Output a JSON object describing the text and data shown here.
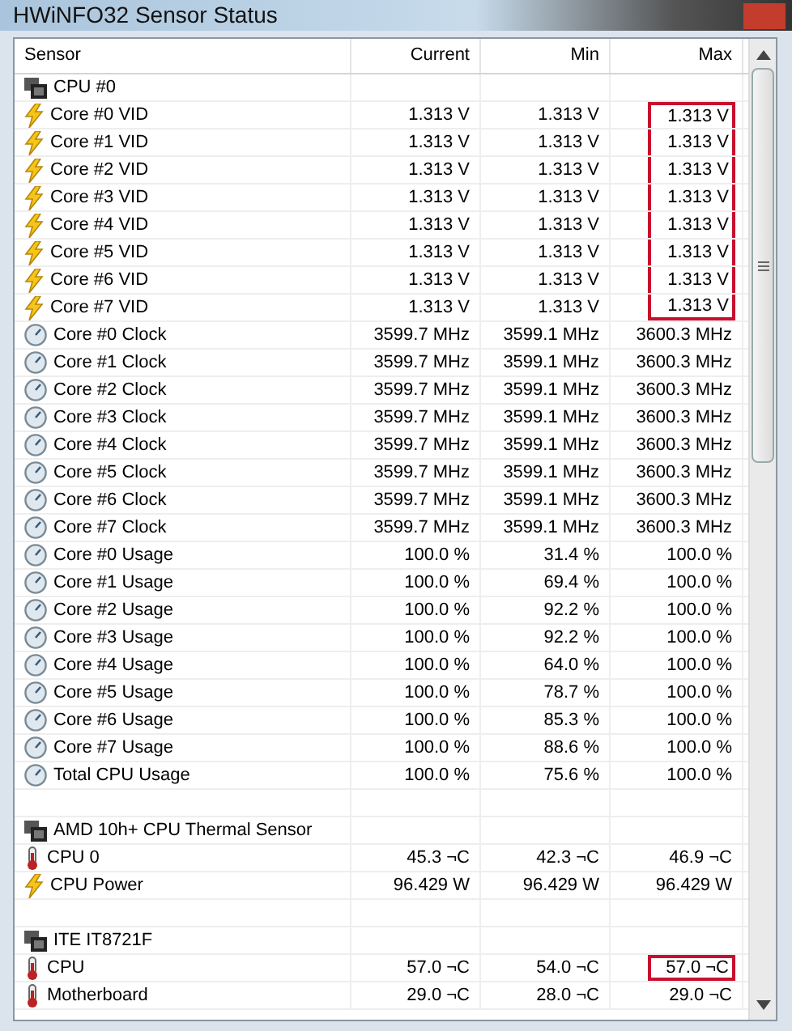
{
  "window": {
    "title": "HWiNFO32 Sensor Status"
  },
  "table": {
    "columns": [
      "Sensor",
      "Current",
      "Min",
      "Max"
    ],
    "rows": [
      {
        "kind": "group",
        "name": "CPU #0"
      },
      {
        "kind": "voltage",
        "name": "Core #0 VID",
        "current": "1.313 V",
        "min": "1.313 V",
        "max": "1.313 V",
        "highlighted": true
      },
      {
        "kind": "voltage",
        "name": "Core #1 VID",
        "current": "1.313 V",
        "min": "1.313 V",
        "max": "1.313 V",
        "highlighted": true
      },
      {
        "kind": "voltage",
        "name": "Core #2 VID",
        "current": "1.313 V",
        "min": "1.313 V",
        "max": "1.313 V",
        "highlighted": true
      },
      {
        "kind": "voltage",
        "name": "Core #3 VID",
        "current": "1.313 V",
        "min": "1.313 V",
        "max": "1.313 V",
        "highlighted": true
      },
      {
        "kind": "voltage",
        "name": "Core #4 VID",
        "current": "1.313 V",
        "min": "1.313 V",
        "max": "1.313 V",
        "highlighted": true
      },
      {
        "kind": "voltage",
        "name": "Core #5 VID",
        "current": "1.313 V",
        "min": "1.313 V",
        "max": "1.313 V",
        "highlighted": true
      },
      {
        "kind": "voltage",
        "name": "Core #6 VID",
        "current": "1.313 V",
        "min": "1.313 V",
        "max": "1.313 V",
        "highlighted": true
      },
      {
        "kind": "voltage",
        "name": "Core #7 VID",
        "current": "1.313 V",
        "min": "1.313 V",
        "max": "1.313 V",
        "highlighted": true
      },
      {
        "kind": "clock",
        "name": "Core #0 Clock",
        "current": "3599.7 MHz",
        "min": "3599.1 MHz",
        "max": "3600.3 MHz",
        "highlighted": false
      },
      {
        "kind": "clock",
        "name": "Core #1 Clock",
        "current": "3599.7 MHz",
        "min": "3599.1 MHz",
        "max": "3600.3 MHz",
        "highlighted": false
      },
      {
        "kind": "clock",
        "name": "Core #2 Clock",
        "current": "3599.7 MHz",
        "min": "3599.1 MHz",
        "max": "3600.3 MHz",
        "highlighted": false
      },
      {
        "kind": "clock",
        "name": "Core #3 Clock",
        "current": "3599.7 MHz",
        "min": "3599.1 MHz",
        "max": "3600.3 MHz",
        "highlighted": false
      },
      {
        "kind": "clock",
        "name": "Core #4 Clock",
        "current": "3599.7 MHz",
        "min": "3599.1 MHz",
        "max": "3600.3 MHz",
        "highlighted": false
      },
      {
        "kind": "clock",
        "name": "Core #5 Clock",
        "current": "3599.7 MHz",
        "min": "3599.1 MHz",
        "max": "3600.3 MHz",
        "highlighted": false
      },
      {
        "kind": "clock",
        "name": "Core #6 Clock",
        "current": "3599.7 MHz",
        "min": "3599.1 MHz",
        "max": "3600.3 MHz",
        "highlighted": false
      },
      {
        "kind": "clock",
        "name": "Core #7 Clock",
        "current": "3599.7 MHz",
        "min": "3599.1 MHz",
        "max": "3600.3 MHz",
        "highlighted": false
      },
      {
        "kind": "usage",
        "name": "Core #0 Usage",
        "current": "100.0 %",
        "min": "31.4 %",
        "max": "100.0 %",
        "highlighted": false
      },
      {
        "kind": "usage",
        "name": "Core #1 Usage",
        "current": "100.0 %",
        "min": "69.4 %",
        "max": "100.0 %",
        "highlighted": false
      },
      {
        "kind": "usage",
        "name": "Core #2 Usage",
        "current": "100.0 %",
        "min": "92.2 %",
        "max": "100.0 %",
        "highlighted": false
      },
      {
        "kind": "usage",
        "name": "Core #3 Usage",
        "current": "100.0 %",
        "min": "92.2 %",
        "max": "100.0 %",
        "highlighted": false
      },
      {
        "kind": "usage",
        "name": "Core #4 Usage",
        "current": "100.0 %",
        "min": "64.0 %",
        "max": "100.0 %",
        "highlighted": false
      },
      {
        "kind": "usage",
        "name": "Core #5 Usage",
        "current": "100.0 %",
        "min": "78.7 %",
        "max": "100.0 %",
        "highlighted": false
      },
      {
        "kind": "usage",
        "name": "Core #6 Usage",
        "current": "100.0 %",
        "min": "85.3 %",
        "max": "100.0 %",
        "highlighted": false
      },
      {
        "kind": "usage",
        "name": "Core #7 Usage",
        "current": "100.0 %",
        "min": "88.6 %",
        "max": "100.0 %",
        "highlighted": false
      },
      {
        "kind": "usage",
        "name": "Total CPU Usage",
        "current": "100.0 %",
        "min": "75.6 %",
        "max": "100.0 %",
        "highlighted": false
      },
      {
        "kind": "spacer"
      },
      {
        "kind": "group",
        "name": "AMD 10h+ CPU Thermal Sensor"
      },
      {
        "kind": "temperature",
        "name": "CPU 0",
        "current": "45.3 ¬C",
        "min": "42.3 ¬C",
        "max": "46.9 ¬C",
        "highlighted": false
      },
      {
        "kind": "power",
        "name": "CPU Power",
        "current": "96.429 W",
        "min": "96.429 W",
        "max": "96.429 W",
        "highlighted": false
      },
      {
        "kind": "spacer"
      },
      {
        "kind": "group",
        "name": "ITE IT8721F"
      },
      {
        "kind": "temperature",
        "name": "CPU",
        "current": "57.0 ¬C",
        "min": "54.0 ¬C",
        "max": "57.0 ¬C",
        "highlighted": true
      },
      {
        "kind": "temperature",
        "name": "Motherboard",
        "current": "29.0 ¬C",
        "min": "28.0 ¬C",
        "max": "29.0 ¬C",
        "highlighted": false
      }
    ]
  }
}
